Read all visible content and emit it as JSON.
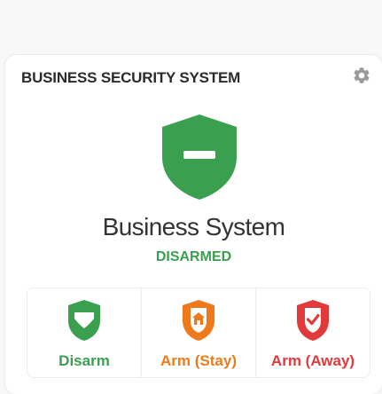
{
  "card": {
    "title": "BUSINESS SECURITY SYSTEM",
    "settings_icon": "gear-icon"
  },
  "system": {
    "name": "Business System",
    "status": "DISARMED",
    "status_icon": "shield-minus-icon"
  },
  "actions": [
    {
      "label": "Disarm",
      "icon": "shield-half-icon",
      "color": "#3aa04f"
    },
    {
      "label": "Arm (Stay)",
      "icon": "shield-home-icon",
      "color": "#ee7a1b"
    },
    {
      "label": "Arm (Away)",
      "icon": "shield-check-icon",
      "color": "#e23a3a"
    }
  ],
  "colors": {
    "disarmed": "#3aa04f",
    "stay": "#ee7a1b",
    "away": "#e23a3a",
    "gear": "#9a9a9a"
  }
}
